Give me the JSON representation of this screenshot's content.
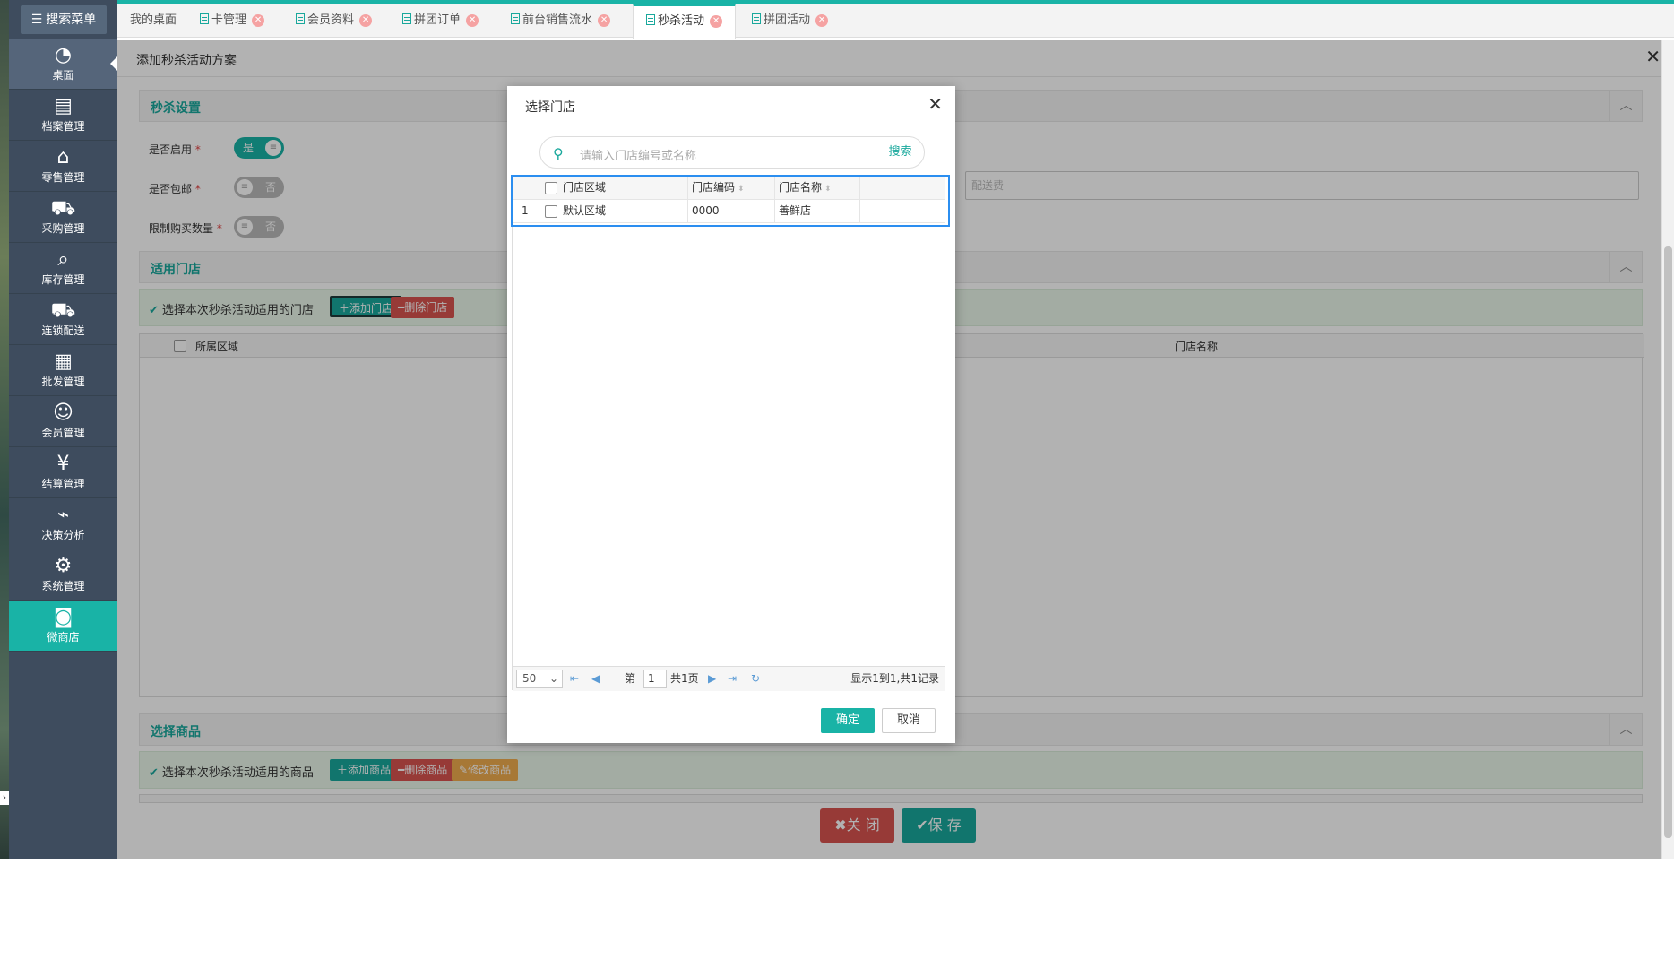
{
  "sidebar": {
    "search_menu": "搜索菜单",
    "items": [
      {
        "label": "桌面",
        "icon": "dashboard-icon"
      },
      {
        "label": "档案管理",
        "icon": "archive-icon"
      },
      {
        "label": "零售管理",
        "icon": "store-icon"
      },
      {
        "label": "采购管理",
        "icon": "purchase-icon"
      },
      {
        "label": "库存管理",
        "icon": "inventory-icon"
      },
      {
        "label": "连锁配送",
        "icon": "truck-icon"
      },
      {
        "label": "批发管理",
        "icon": "wholesale-icon"
      },
      {
        "label": "会员管理",
        "icon": "member-icon"
      },
      {
        "label": "结算管理",
        "icon": "settlement-icon"
      },
      {
        "label": "决策分析",
        "icon": "chart-icon"
      },
      {
        "label": "系统管理",
        "icon": "gear-icon"
      },
      {
        "label": "微商店",
        "icon": "shop-bag-icon"
      }
    ]
  },
  "tabs": [
    {
      "label": "我的桌面",
      "closable": false
    },
    {
      "label": "卡管理",
      "closable": true
    },
    {
      "label": "会员资料",
      "closable": true
    },
    {
      "label": "拼团订单",
      "closable": true
    },
    {
      "label": "前台销售流水",
      "closable": true
    },
    {
      "label": "秒杀活动",
      "closable": true,
      "active": true
    },
    {
      "label": "拼团活动",
      "closable": true
    }
  ],
  "page": {
    "title": "添加秒杀活动方案",
    "section_seckill": "秒杀设置",
    "fields": {
      "enabled_label": "是否启用",
      "enabled_value": "是",
      "free_ship_label": "是否包邮",
      "free_ship_value": "否",
      "limit_label": "限制购买数量",
      "limit_value": "否",
      "required_mark": "*",
      "shipping_fee_placeholder": "配送费"
    },
    "section_stores": "适用门店",
    "stores_hint": "选择本次秒杀活动适用的门店",
    "add_store": "添加门店",
    "del_store": "删除门店",
    "stores_grid_headers": [
      "所属区域",
      "门店名称"
    ],
    "section_goods": "选择商品",
    "goods_hint": "选择本次秒杀活动适用的商品",
    "add_goods": "添加商品",
    "del_goods": "删除商品",
    "edit_goods": "修改商品",
    "close_btn": "关 闭",
    "save_btn": "保 存"
  },
  "dialog": {
    "title": "选择门店",
    "search_placeholder": "请输入门店编号或名称",
    "search_btn": "搜索",
    "headers": [
      "门店区域",
      "门店编码",
      "门店名称"
    ],
    "rows": [
      {
        "no": "1",
        "region": "默认区域",
        "code": "0000",
        "name": "善鲜店"
      }
    ],
    "pager": {
      "page_size": "50",
      "page_prefix": "第",
      "page_value": "1",
      "page_total": "共1页",
      "summary": "显示1到1,共1记录"
    },
    "ok": "确定",
    "cancel": "取消"
  }
}
